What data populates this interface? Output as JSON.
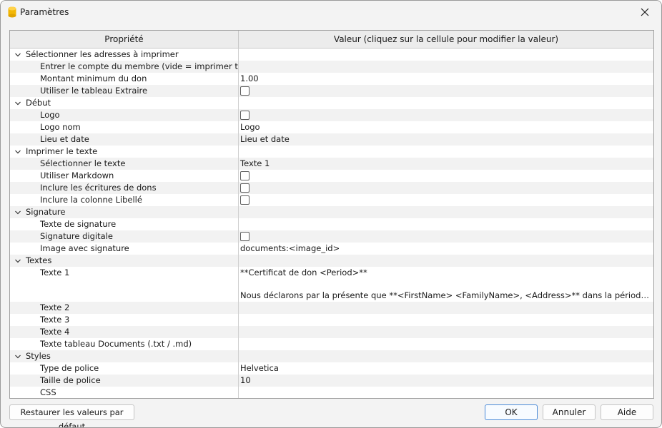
{
  "window": {
    "title": "Paramètres"
  },
  "grid": {
    "col_property": "Propriété",
    "col_value": "Valeur (cliquez sur la cellule pour modifier la valeur)"
  },
  "rows": [
    {
      "kind": "group",
      "label": "Sélectionner les adresses à imprimer"
    },
    {
      "kind": "prop",
      "label": "Entrer le compte du membre (vide = imprimer tout)",
      "value": ""
    },
    {
      "kind": "prop",
      "label": "Montant minimum du don",
      "value": "1.00"
    },
    {
      "kind": "check",
      "label": "Utiliser le tableau Extraire",
      "checked": false
    },
    {
      "kind": "group",
      "label": "Début"
    },
    {
      "kind": "check",
      "label": "Logo",
      "checked": false
    },
    {
      "kind": "prop",
      "label": "Logo nom",
      "value": "Logo"
    },
    {
      "kind": "prop",
      "label": "Lieu et date",
      "value": "Lieu et date"
    },
    {
      "kind": "group",
      "label": "Imprimer le texte"
    },
    {
      "kind": "prop",
      "label": "Sélectionner le texte",
      "value": "Texte 1"
    },
    {
      "kind": "check",
      "label": "Utiliser Markdown",
      "checked": false
    },
    {
      "kind": "check",
      "label": "Inclure les écritures de dons",
      "checked": false
    },
    {
      "kind": "check",
      "label": "Inclure la colonne Libellé",
      "checked": false
    },
    {
      "kind": "group",
      "label": "Signature"
    },
    {
      "kind": "prop",
      "label": "Texte de signature",
      "value": ""
    },
    {
      "kind": "check",
      "label": "Signature digitale",
      "checked": false
    },
    {
      "kind": "prop",
      "label": "Image avec signature",
      "value": "documents:<image_id>"
    },
    {
      "kind": "group",
      "label": "Textes"
    },
    {
      "kind": "multi",
      "label": "Texte 1",
      "lines": [
        "**Certificat de don <Period>**",
        "",
        "Nous déclarons par la présente que **<FirstName> <FamilyName>, <Address>** dans la période **<Start..."
      ]
    },
    {
      "kind": "prop",
      "label": "Texte 2",
      "value": ""
    },
    {
      "kind": "prop",
      "label": "Texte 3",
      "value": ""
    },
    {
      "kind": "prop",
      "label": "Texte 4",
      "value": ""
    },
    {
      "kind": "prop",
      "label": "Texte tableau Documents (.txt / .md)",
      "value": ""
    },
    {
      "kind": "group",
      "label": "Styles"
    },
    {
      "kind": "prop",
      "label": "Type de police",
      "value": "Helvetica"
    },
    {
      "kind": "prop",
      "label": "Taille de police",
      "value": "10"
    },
    {
      "kind": "prop",
      "label": "CSS",
      "value": ""
    }
  ],
  "buttons": {
    "reset": "Restaurer les valeurs par défaut",
    "ok": "OK",
    "cancel": "Annuler",
    "help": "Aide"
  },
  "colors": {
    "accent": "#4a8ad8",
    "app_icon": "#f2b705"
  }
}
